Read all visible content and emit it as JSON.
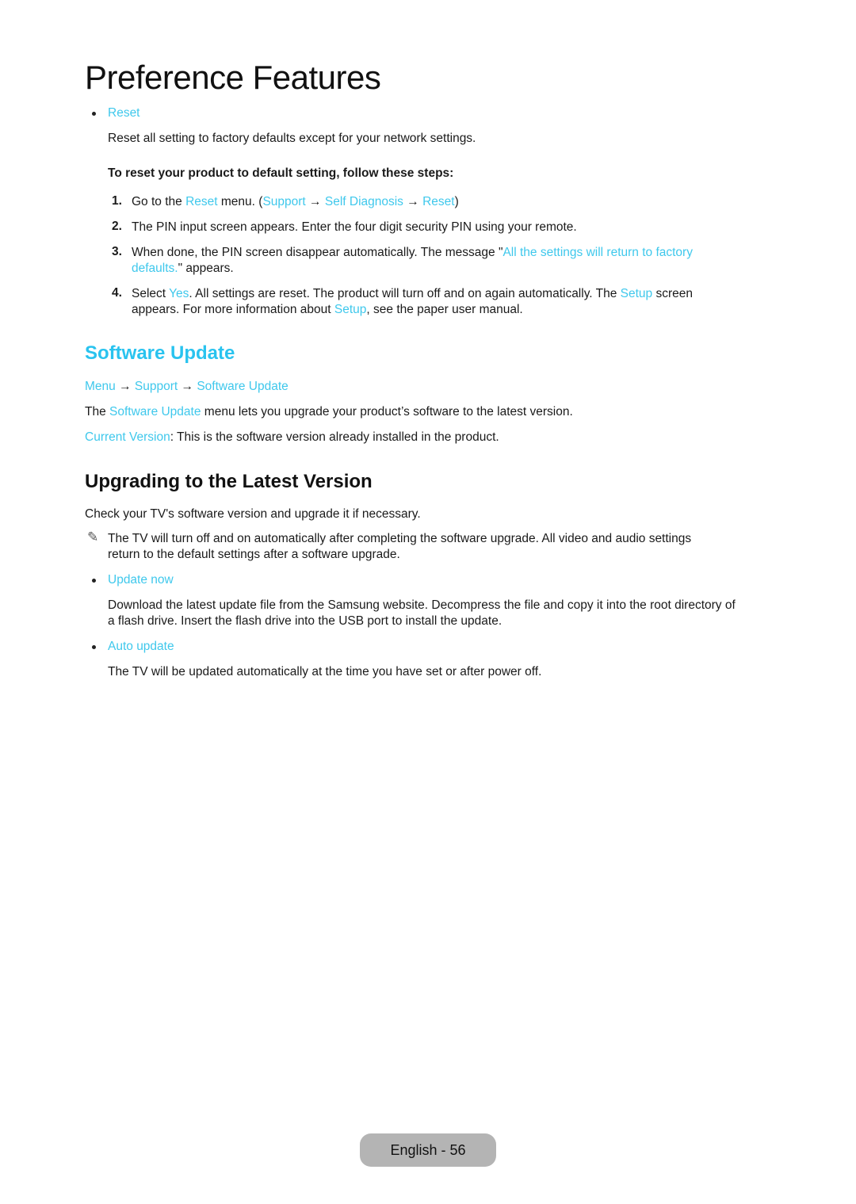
{
  "page": {
    "title": "Preference Features",
    "accent_color": "#3fc8ec"
  },
  "reset_section": {
    "bullet_label": "Reset",
    "description": "Reset all setting to factory defaults except for your network settings.",
    "steps_intro": "To reset your product to default setting, follow these steps:",
    "steps": [
      {
        "num": "1.",
        "parts": [
          "Go to the ",
          "Reset",
          " menu. (",
          "Support",
          " → ",
          "Self Diagnosis",
          " → ",
          "Reset",
          ")"
        ]
      },
      {
        "num": "2.",
        "text": "The PIN input screen appears. Enter the four digit security PIN using your remote."
      },
      {
        "num": "3.",
        "line1_a": "When done, the PIN screen disappear automatically. The message \"",
        "line1_link": "All the settings will return to factory",
        "line2_link": "defaults.",
        "line2_b": "\" appears."
      },
      {
        "num": "4.",
        "line1_a": "Select ",
        "line1_link1": "Yes",
        "line1_b": ". All settings are reset. The product will turn off and on again automatically. The ",
        "line1_link2": "Setup",
        "line1_c": " screen",
        "line2_a": "appears. For more information about ",
        "line2_link": "Setup",
        "line2_b": ", see the paper user manual."
      }
    ]
  },
  "software_update": {
    "heading": "Software Update",
    "breadcrumb": [
      "Menu",
      "Support",
      "Software Update"
    ],
    "breadcrumb_sep": "→",
    "intro_a": "The ",
    "intro_link": "Software Update",
    "intro_b": " menu lets you upgrade your product’s software to the latest version.",
    "current_version_label": "Current Version",
    "current_version_text": ": This is the software version already installed in the product."
  },
  "upgrading": {
    "heading": "Upgrading to the Latest Version",
    "intro": "Check your TV's software version and upgrade it if necessary.",
    "note_icon": "pencil-note-icon",
    "note_line1": "The TV will turn off and on automatically after completing the software upgrade. All video and audio settings",
    "note_line2": "return to the default settings after a software upgrade.",
    "options": [
      {
        "label": "Update now",
        "line1": "Download the latest update file from the Samsung website. Decompress the file and copy it into the root directory of",
        "line2": "a flash drive. Insert the flash drive into the USB port to install the update."
      },
      {
        "label": "Auto update",
        "line1": "The TV will be updated automatically at the time you have set or after power off."
      }
    ]
  },
  "footer": {
    "page_label": "English - 56"
  }
}
